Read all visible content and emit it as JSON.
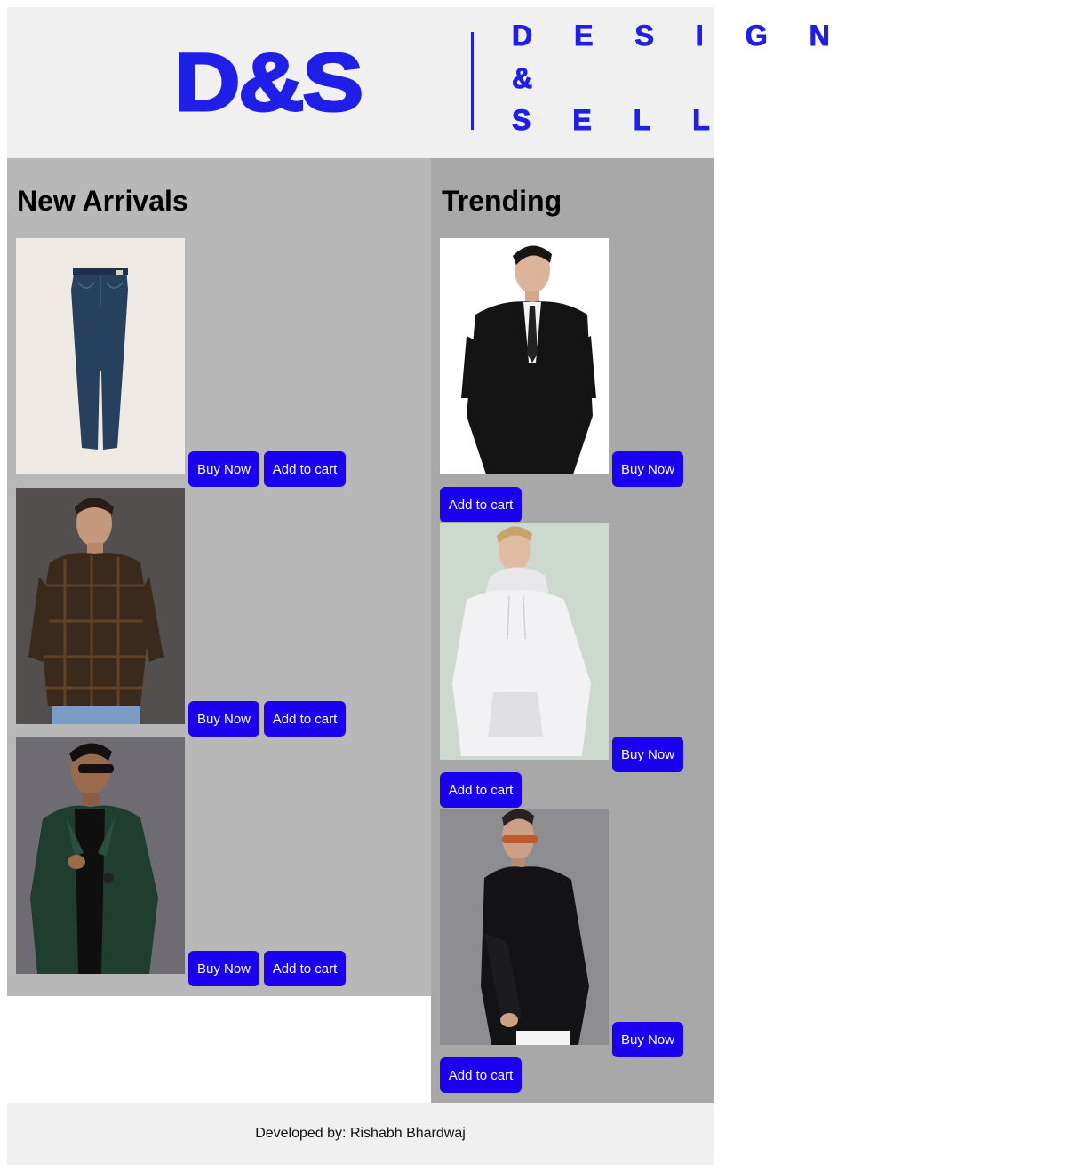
{
  "brand": {
    "logo_text": "D&S",
    "tagline_row1": "DESIGN",
    "tagline_row2": "&",
    "tagline_row3": "SELL",
    "color": "#1f1fe8"
  },
  "sections": {
    "new_arrivals": {
      "title": "New Arrivals",
      "products": [
        {
          "image": "jeans-image",
          "buy_label": "Buy Now",
          "cart_label": "Add to cart"
        },
        {
          "image": "plaid-shirt-image",
          "buy_label": "Buy Now",
          "cart_label": "Add to cart"
        },
        {
          "image": "green-jacket-image",
          "buy_label": "Buy Now",
          "cart_label": "Add to cart"
        }
      ]
    },
    "trending": {
      "title": "Trending",
      "products": [
        {
          "image": "black-suit-image",
          "buy_label": "Buy Now",
          "cart_label": "Add to cart"
        },
        {
          "image": "white-hoodie-image",
          "buy_label": "Buy Now",
          "cart_label": "Add to cart"
        },
        {
          "image": "black-sweater-image",
          "buy_label": "Buy Now",
          "cart_label": "Add to cart"
        }
      ]
    }
  },
  "footer": {
    "text": "Developed by: Rishabh Bhardwaj"
  },
  "colors": {
    "header_bg": "#f0f0f0",
    "new_arrivals_bg": "#b8b8b8",
    "trending_bg": "#a8a8a8",
    "button_bg": "#1b00f0",
    "button_text": "#ffffff"
  }
}
